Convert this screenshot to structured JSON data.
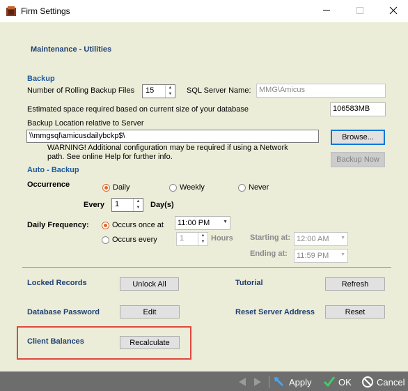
{
  "window": {
    "title": "Firm Settings"
  },
  "header": {
    "section_title": "Maintenance - Utilities"
  },
  "backup": {
    "heading": "Backup",
    "rolling_label": "Number of Rolling Backup Files",
    "rolling_value": "15",
    "sql_label": "SQL Server Name:",
    "sql_value": "MMG\\Amicus",
    "estimate_label": "Estimated space required based on current size of your database",
    "estimate_value": "106583MB",
    "location_label": "Backup Location relative to Server",
    "location_value": "\\\\mmgsql\\amicusdailybckp$\\",
    "browse_label": "Browse...",
    "warning_line1": "WARNING! Additional configuration may be required if using a Network",
    "warning_line2": "path. See online Help for further info.",
    "backup_now_label": "Backup Now"
  },
  "auto_backup": {
    "heading": "Auto - Backup",
    "occurrence_label": "Occurrence",
    "options": [
      "Daily",
      "Weekly",
      "Never"
    ],
    "selected": "Daily",
    "every_label": "Every",
    "every_value": "1",
    "days_label": "Day(s)",
    "daily_freq_label": "Daily Frequency:",
    "once_label": "Occurs once at",
    "once_value": "11:00 PM",
    "every2_label": "Occurs every",
    "every2_value": "1",
    "hours_label": "Hours",
    "starting_label": "Starting at:",
    "starting_value": "12:00 AM",
    "ending_label": "Ending at:",
    "ending_value": "11:59 PM"
  },
  "utilities": {
    "locked_label": "Locked Records",
    "unlock_label": "Unlock All",
    "tutorial_label": "Tutorial",
    "refresh_label": "Refresh",
    "db_password_label": "Database Password",
    "edit_label": "Edit",
    "reset_server_label": "Reset Server Address",
    "reset_label": "Reset",
    "client_balances_label": "Client Balances",
    "recalculate_label": "Recalculate"
  },
  "footer": {
    "apply_label": "Apply",
    "ok_label": "OK",
    "cancel_label": "Cancel"
  },
  "colors": {
    "accent": "#1f3f73",
    "radio": "#e06a2a",
    "highlight": "#e0473e",
    "panel": "#ebedd9",
    "footer": "#6d6d6d"
  },
  "icons": [
    "app-icon",
    "minimize-icon",
    "maximize-icon",
    "close-icon",
    "back-arrow-icon",
    "forward-arrow-icon",
    "apply-icon",
    "ok-check-icon",
    "cancel-icon"
  ]
}
